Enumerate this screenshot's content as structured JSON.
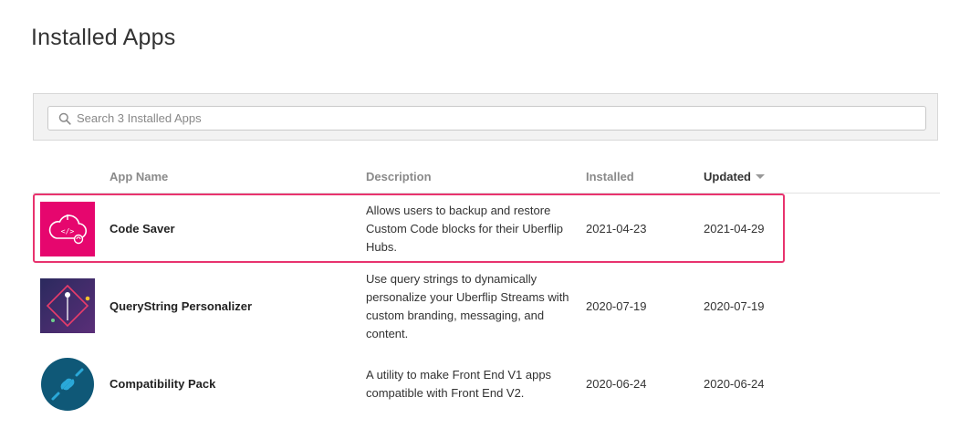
{
  "page": {
    "title": "Installed Apps"
  },
  "search": {
    "placeholder": "Search 3 Installed Apps"
  },
  "table": {
    "columns": {
      "app_name": "App Name",
      "description": "Description",
      "installed": "Installed",
      "updated": "Updated"
    },
    "sorted_column": "updated",
    "rows": [
      {
        "name": "Code Saver",
        "description": "Allows users to backup and restore Custom Code blocks for their Uberflip Hubs.",
        "installed": "2021-04-23",
        "updated": "2021-04-29",
        "icon": "code-saver-icon",
        "highlighted": true
      },
      {
        "name": "QueryString Personalizer",
        "description": "Use query strings to dynamically personalize your Uberflip Streams with custom branding, messaging, and content.",
        "installed": "2020-07-19",
        "updated": "2020-07-19",
        "icon": "querystring-personalizer-icon",
        "highlighted": false
      },
      {
        "name": "Compatibility Pack",
        "description": "A utility to make Front End V1 apps compatible with Front End V2.",
        "installed": "2020-06-24",
        "updated": "2020-06-24",
        "icon": "compatibility-pack-icon",
        "highlighted": false
      }
    ]
  },
  "colors": {
    "highlight_border": "#e8336e",
    "code_saver_bg": "#e6066e",
    "querystring_bg": "#3b2f6b",
    "compatibility_bg": "#0f5877"
  }
}
